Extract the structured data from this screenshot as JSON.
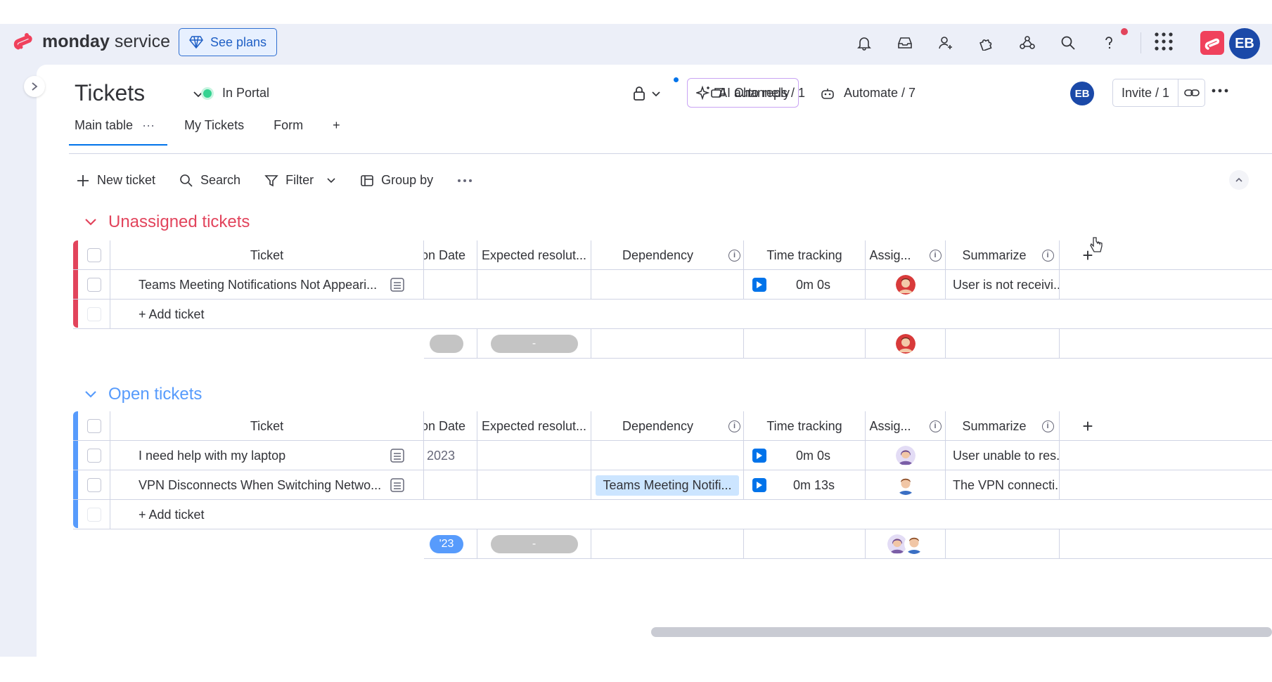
{
  "app": {
    "brand_bold": "monday",
    "brand_light": "service",
    "see_plans": "See plans",
    "user_initials": "EB"
  },
  "topbar_icons": [
    "bell-icon",
    "inbox-icon",
    "invite-user-icon",
    "apps-puzzle-icon",
    "integrations-icon",
    "search-icon",
    "help-icon",
    "grid-menu-icon"
  ],
  "board": {
    "title": "Tickets",
    "portal_label": "In Portal",
    "ai_auto_reply": "AI auto reply",
    "channels": "Channels / 1",
    "automate": "Automate / 7",
    "avatar": "EB",
    "invite": "Invite / 1"
  },
  "tabs": [
    {
      "label": "Main table",
      "active": true
    },
    {
      "label": "My Tickets",
      "active": false
    },
    {
      "label": "Form",
      "active": false
    }
  ],
  "tab_add": "+",
  "toolbar": {
    "new_ticket": "New ticket",
    "search": "Search",
    "filter": "Filter",
    "group_by": "Group by"
  },
  "columns": {
    "ticket": "Ticket",
    "date": "on Date",
    "expected": "Expected resolut...",
    "dependency": "Dependency",
    "time_tracking": "Time tracking",
    "assignee": "Assig...",
    "summarize": "Summarize",
    "add": "+"
  },
  "groups": [
    {
      "title": "Unassigned tickets",
      "color": "#e2445c",
      "rows": [
        {
          "ticket": "Teams Meeting Notifications Not Appeari...",
          "date": "",
          "dependency": "",
          "time": "0m 0s",
          "summary": "User is not receivi..."
        }
      ],
      "add_label": "+ Add ticket",
      "summary_date": "",
      "summary_expected": "-"
    },
    {
      "title": "Open tickets",
      "color": "#579bfc",
      "rows": [
        {
          "ticket": "I need help with my laptop",
          "date": "2023",
          "dependency": "",
          "time": "0m 0s",
          "summary": "User unable to res..."
        },
        {
          "ticket": "VPN Disconnects When Switching Netwo...",
          "date": "",
          "dependency": "Teams Meeting Notifi...",
          "time": "0m 13s",
          "summary": "The VPN connecti..."
        }
      ],
      "add_label": "+ Add ticket",
      "summary_date": "'23",
      "summary_expected": "-"
    }
  ],
  "colors": {
    "accent": "#0073ea",
    "unassigned": "#e2445c",
    "open": "#579bfc"
  }
}
